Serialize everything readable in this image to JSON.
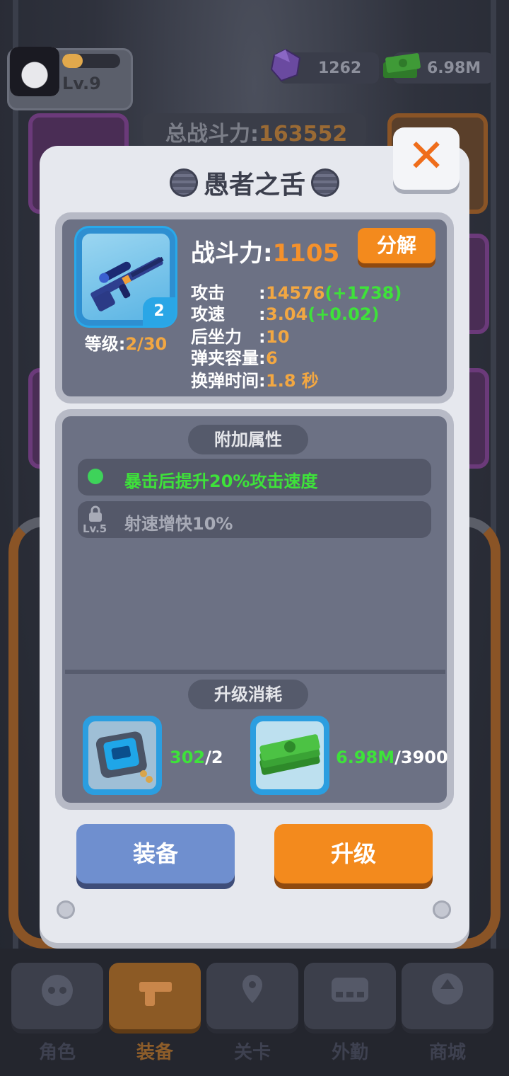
{
  "player": {
    "level_label": "Lv.9",
    "xp_fraction": 0.35
  },
  "resources": {
    "gems": "1262",
    "cash": "6.98M"
  },
  "total_power": {
    "label": "总战斗力:",
    "value": "163552"
  },
  "dialog": {
    "title": "愚者之舌",
    "close_icon": "close-icon",
    "weapon": {
      "icon": "sniper-rifle-icon",
      "badge": "2",
      "level_label": "等级:",
      "level_value": "2/30",
      "power_label": "战斗力:",
      "power_value": "1105",
      "decompose_label": "分解"
    },
    "stats": [
      {
        "label": "攻击",
        "colon": ":",
        "value": "14576",
        "bonus": "(+1738)"
      },
      {
        "label": "攻速",
        "colon": ":",
        "value": "3.04",
        "bonus": "(+0.02)"
      },
      {
        "label": "后坐力",
        "colon": ":",
        "value": "10",
        "bonus": ""
      },
      {
        "label": "弹夹容量",
        "colon": ":",
        "value": "6",
        "bonus": ""
      },
      {
        "label": "换弹时间",
        "colon": ":",
        "value": "1.8 秒",
        "bonus": ""
      }
    ],
    "extra_attributes": {
      "header": "附加属性",
      "items": [
        {
          "text": "暴击后提升20%攻击速度",
          "unlocked": true
        },
        {
          "text": "射速增快10%",
          "unlocked": false,
          "lock_level": "Lv.5"
        }
      ]
    },
    "upgrade_cost": {
      "header": "升级消耗",
      "items": [
        {
          "icon": "chip-icon",
          "have": "302",
          "need": "/2"
        },
        {
          "icon": "cash-stack-icon",
          "have": "6.98M",
          "need": "/3900"
        }
      ]
    },
    "buttons": {
      "equip": "装备",
      "upgrade": "升级"
    }
  },
  "nav": [
    {
      "label": "角色",
      "icon": "skull-icon",
      "active": false
    },
    {
      "label": "装备",
      "icon": "gun-icon",
      "active": true
    },
    {
      "label": "关卡",
      "icon": "map-pin-icon",
      "active": false
    },
    {
      "label": "外勤",
      "icon": "vehicle-icon",
      "active": false
    },
    {
      "label": "商城",
      "icon": "shop-icon",
      "active": false
    }
  ],
  "colors": {
    "accent_orange": "#f38a1d",
    "bonus_green": "#3ee23a",
    "value_orange": "#f2a742",
    "rarity_blue": "#2b9ee0"
  }
}
